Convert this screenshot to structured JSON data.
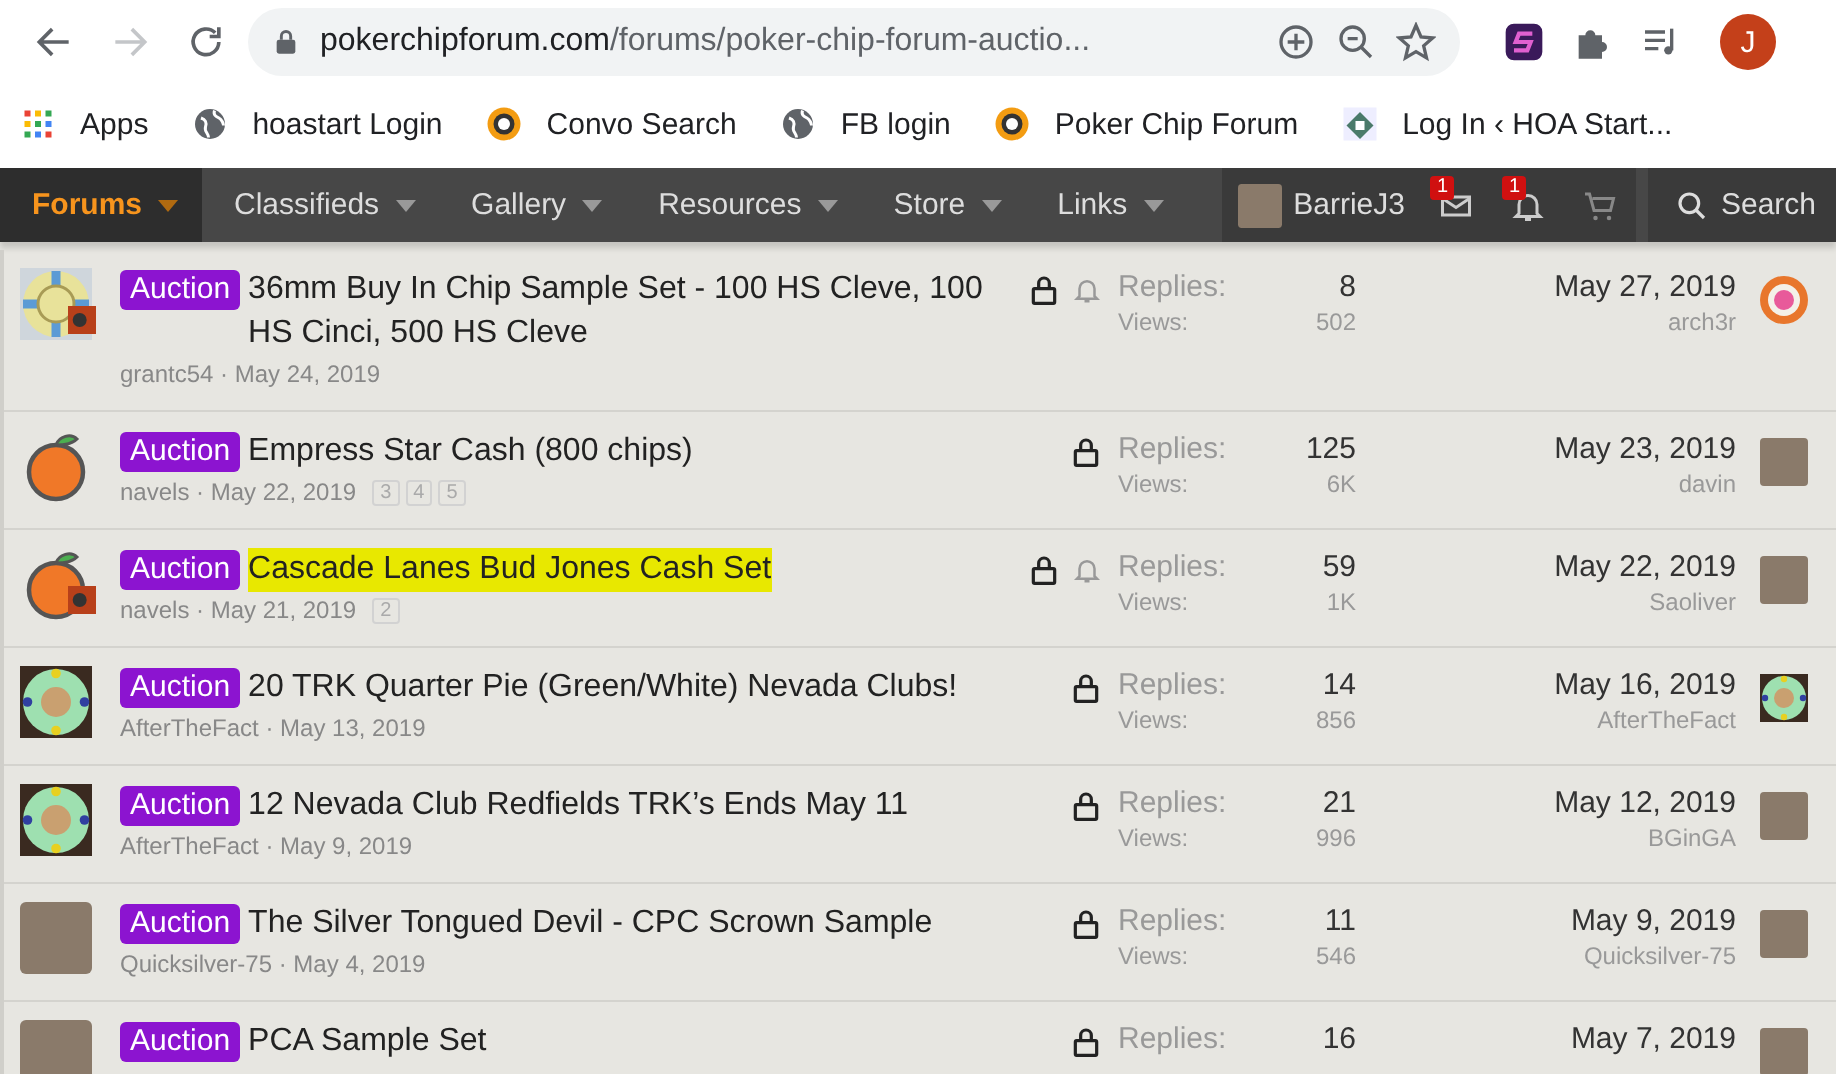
{
  "browser": {
    "nav_buttons": [
      {
        "kind": "back",
        "disabled": false
      },
      {
        "kind": "forward",
        "disabled": true
      },
      {
        "kind": "reload",
        "disabled": false
      }
    ],
    "address": {
      "domain": "pokerchipforum.com",
      "path": "/forums/poker-chip-forum-auctio..."
    },
    "profile": {
      "initial": "J"
    }
  },
  "bookmarks": [
    {
      "label": "Apps",
      "kind": "apps"
    },
    {
      "label": "hoastart Login",
      "kind": "globe"
    },
    {
      "label": "Convo Search",
      "kind": "chip"
    },
    {
      "label": "FB login",
      "kind": "globe"
    },
    {
      "label": "Poker Chip Forum",
      "kind": "chip"
    },
    {
      "label": "Log In ‹ HOA Start...",
      "kind": "house"
    }
  ],
  "nav": {
    "tabs": [
      {
        "label": "Forums",
        "selected": true
      },
      {
        "label": "Classifieds",
        "selected": false
      },
      {
        "label": "Gallery",
        "selected": false
      },
      {
        "label": "Resources",
        "selected": false
      },
      {
        "label": "Store",
        "selected": false
      },
      {
        "label": "Links",
        "selected": false
      }
    ],
    "user": {
      "name": "BarrieJ3"
    },
    "alerts": [
      {
        "kind": "mail",
        "badge": "1"
      },
      {
        "kind": "bell",
        "badge": "1"
      },
      {
        "kind": "cart"
      }
    ],
    "search": {
      "label": "Search"
    }
  },
  "threads": [
    {
      "avatar": {
        "kind": "yellow-chip"
      },
      "overlay": true,
      "prefix": "Auction",
      "title": "36mm Buy In Chip Sample Set - 100 HS Cleve, 100 HS Cinci, 500 HS Cleve",
      "highlighted": false,
      "byline": "grantc54 · May 24, 2019",
      "locked": true,
      "watched": true,
      "replies_label": "Replies:",
      "replies": "8",
      "views_label": "Views:",
      "views": "502",
      "last_date": "May 27, 2019",
      "last_user": "arch3r",
      "last_avatar": {
        "kind": "orange-chip"
      }
    },
    {
      "avatar": {
        "kind": "orange"
      },
      "overlay": false,
      "prefix": "Auction",
      "title": "Empress Star Cash (800 chips)",
      "highlighted": false,
      "byline": "navels · May 22, 2019",
      "pages": [
        "3",
        "4",
        "5"
      ],
      "locked": true,
      "watched": false,
      "replies_label": "Replies:",
      "replies": "125",
      "views_label": "Views:",
      "views": "6K",
      "last_date": "May 23, 2019",
      "last_user": "davin",
      "last_avatar": {
        "kind": "photo"
      }
    },
    {
      "avatar": {
        "kind": "orange"
      },
      "overlay": true,
      "prefix": "Auction",
      "title": "Cascade Lanes Bud Jones Cash Set",
      "highlighted": true,
      "byline": "navels · May 21, 2019",
      "pages": [
        "2"
      ],
      "locked": true,
      "watched": true,
      "replies_label": "Replies:",
      "replies": "59",
      "views_label": "Views:",
      "views": "1K",
      "last_date": "May 22, 2019",
      "last_user": "Saoliver",
      "last_avatar": {
        "kind": "photo"
      }
    },
    {
      "avatar": {
        "kind": "green-chip"
      },
      "overlay": false,
      "prefix": "Auction",
      "title": "20 TRK Quarter Pie (Green/White) Nevada Clubs!",
      "highlighted": false,
      "byline": "AfterTheFact · May 13, 2019",
      "locked": true,
      "watched": false,
      "replies_label": "Replies:",
      "replies": "14",
      "views_label": "Views:",
      "views": "856",
      "last_date": "May 16, 2019",
      "last_user": "AfterTheFact",
      "last_avatar": {
        "kind": "green-chip"
      }
    },
    {
      "avatar": {
        "kind": "green-chip"
      },
      "overlay": false,
      "prefix": "Auction",
      "title": "12 Nevada Club Redfields TRK’s Ends May 11",
      "highlighted": false,
      "byline": "AfterTheFact · May 9, 2019",
      "locked": true,
      "watched": false,
      "replies_label": "Replies:",
      "replies": "21",
      "views_label": "Views:",
      "views": "996",
      "last_date": "May 12, 2019",
      "last_user": "BGinGA",
      "last_avatar": {
        "kind": "photo"
      }
    },
    {
      "avatar": {
        "kind": "photo"
      },
      "overlay": false,
      "prefix": "Auction",
      "title": "The Silver Tongued Devil - CPC Scrown Sample",
      "highlighted": false,
      "byline": "Quicksilver-75 · May 4, 2019",
      "locked": true,
      "watched": false,
      "replies_label": "Replies:",
      "replies": "11",
      "views_label": "Views:",
      "views": "546",
      "last_date": "May 9, 2019",
      "last_user": "Quicksilver-75",
      "last_avatar": {
        "kind": "photo"
      }
    },
    {
      "avatar": {
        "kind": "photo"
      },
      "overlay": false,
      "prefix": "Auction",
      "title": "PCA Sample Set",
      "highlighted": false,
      "locked": true,
      "watched": false,
      "replies_label": "Replies:",
      "replies": "16",
      "last_date": "May 7, 2019",
      "last_avatar": {
        "kind": "photo"
      }
    }
  ]
}
